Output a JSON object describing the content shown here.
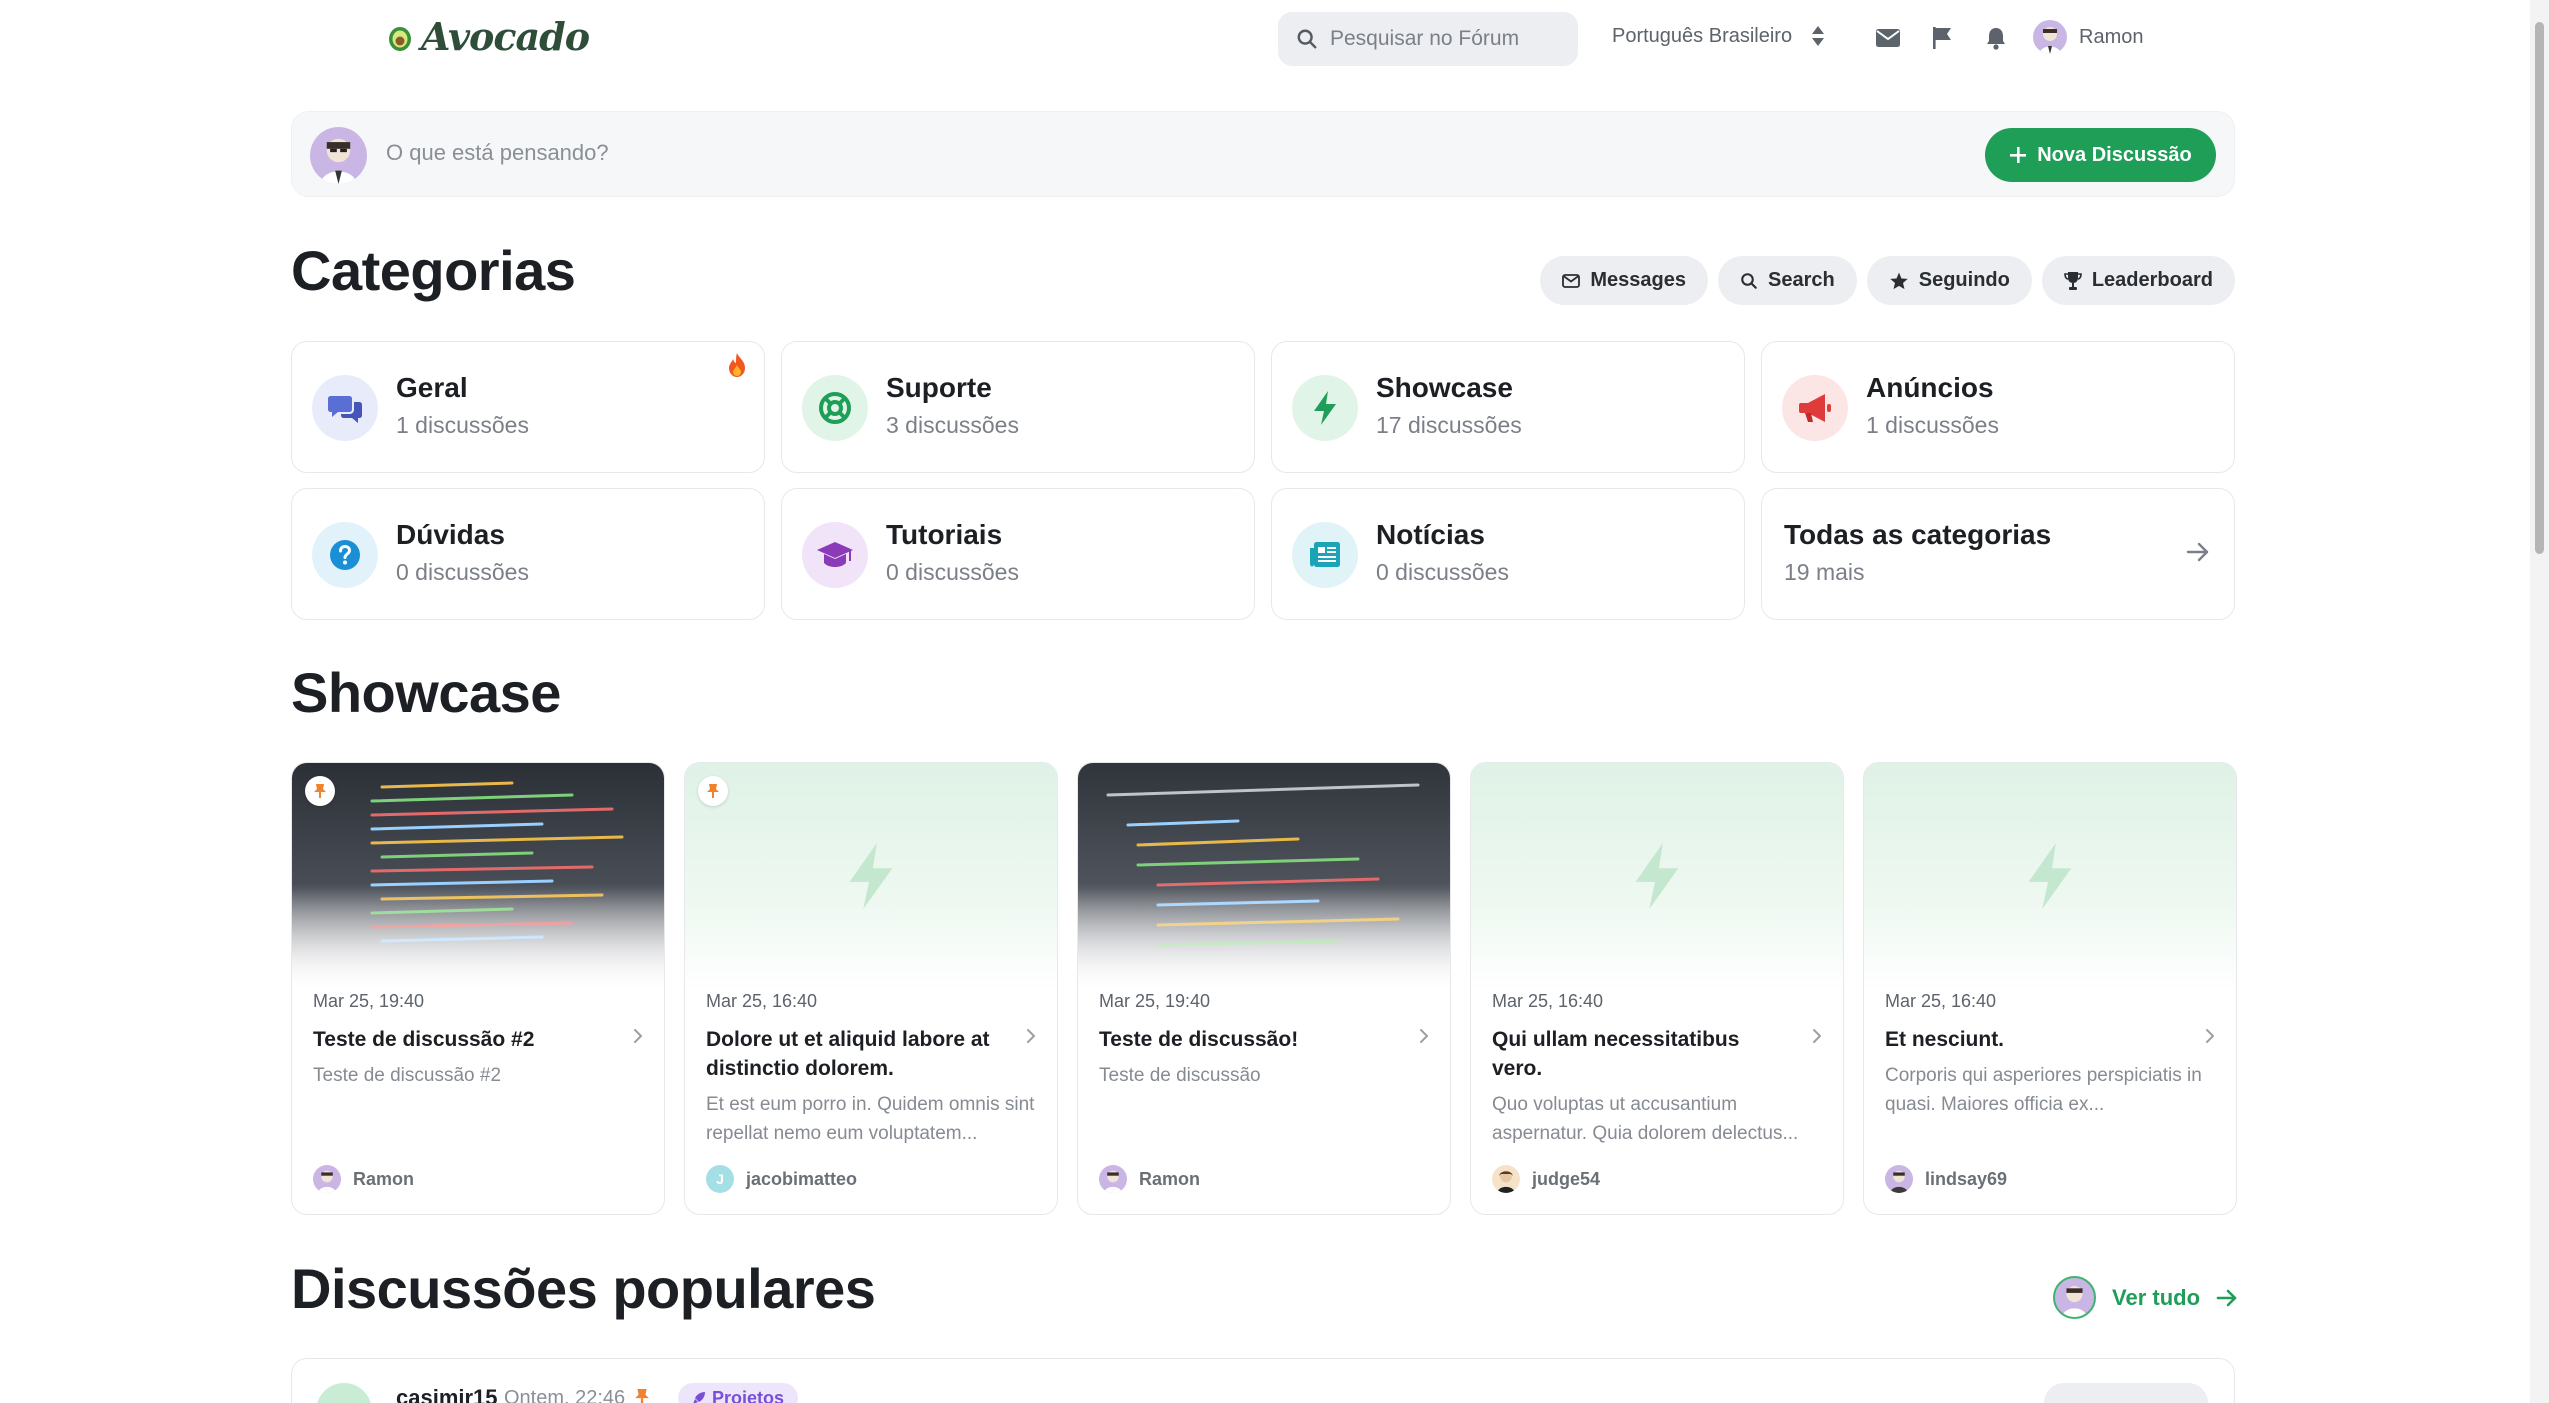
{
  "header": {
    "brand": "Avocado",
    "search_placeholder": "Pesquisar no Fórum",
    "language": "Português Brasileiro",
    "username": "Ramon"
  },
  "composer": {
    "placeholder": "O que está pensando?",
    "new_button": "Nova Discussão"
  },
  "categories_section": {
    "title": "Categorias",
    "pills": [
      "Messages",
      "Search",
      "Seguindo",
      "Leaderboard"
    ],
    "items": [
      {
        "name": "Geral",
        "count": "1 discussões",
        "icon": "chat-bubbles-icon",
        "color": "#5b6ed6",
        "bg": "#e8ebfa"
      },
      {
        "name": "Suporte",
        "count": "3 discussões",
        "icon": "lifebuoy-icon",
        "color": "#1e9e56",
        "bg": "#e1f4e8"
      },
      {
        "name": "Showcase",
        "count": "17 discussões",
        "icon": "bolt-icon",
        "color": "#1e9e56",
        "bg": "#e1f4e8"
      },
      {
        "name": "Anúncios",
        "count": "1 discussões",
        "icon": "megaphone-icon",
        "color": "#e03b3b",
        "bg": "#fbe5e5"
      },
      {
        "name": "Dúvidas",
        "count": "0 discussões",
        "icon": "question-icon",
        "color": "#1b8fd6",
        "bg": "#e2f2fb"
      },
      {
        "name": "Tutoriais",
        "count": "0 discussões",
        "icon": "graduation-cap-icon",
        "color": "#8b3bb8",
        "bg": "#f1e4f8"
      },
      {
        "name": "Notícias",
        "count": "0 discussões",
        "icon": "newspaper-icon",
        "color": "#1ba3b8",
        "bg": "#e0f4f7"
      }
    ],
    "all": {
      "name": "Todas as categorias",
      "count": "19 mais"
    }
  },
  "showcase": {
    "title": "Showcase",
    "cards": [
      {
        "date": "Mar 25, 19:40",
        "title": "Teste de discussão #2",
        "excerpt": "Teste de discussão #2",
        "author": "Ramon",
        "thumb": "code",
        "pinned": true
      },
      {
        "date": "Mar 25, 16:40",
        "title": "Dolore ut et aliquid labore at distinctio dolorem.",
        "excerpt": "Et est eum porro in. Quidem omnis sint repellat nemo eum voluptatem...",
        "author": "jacobimatteo",
        "thumb": "green",
        "pinned": true
      },
      {
        "date": "Mar 25, 19:40",
        "title": "Teste de discussão!",
        "excerpt": "Teste de discussão",
        "author": "Ramon",
        "thumb": "code",
        "pinned": false
      },
      {
        "date": "Mar 25, 16:40",
        "title": "Qui ullam necessitatibus vero.",
        "excerpt": "Quo voluptas ut accusantium aspernatur. Quia dolorem delectus...",
        "author": "judge54",
        "thumb": "green",
        "pinned": false
      },
      {
        "date": "Mar 25, 16:40",
        "title": "Et nesciunt.",
        "excerpt": "Corporis qui asperiores perspiciatis in quasi. Maiores officia ex...",
        "author": "lindsay69",
        "thumb": "green",
        "pinned": false
      }
    ]
  },
  "popular": {
    "title": "Discussões populares",
    "see_all": "Ver tudo",
    "first": {
      "user": "casimir15",
      "time": "Ontem, 22:46",
      "tag": "Projetos"
    }
  }
}
